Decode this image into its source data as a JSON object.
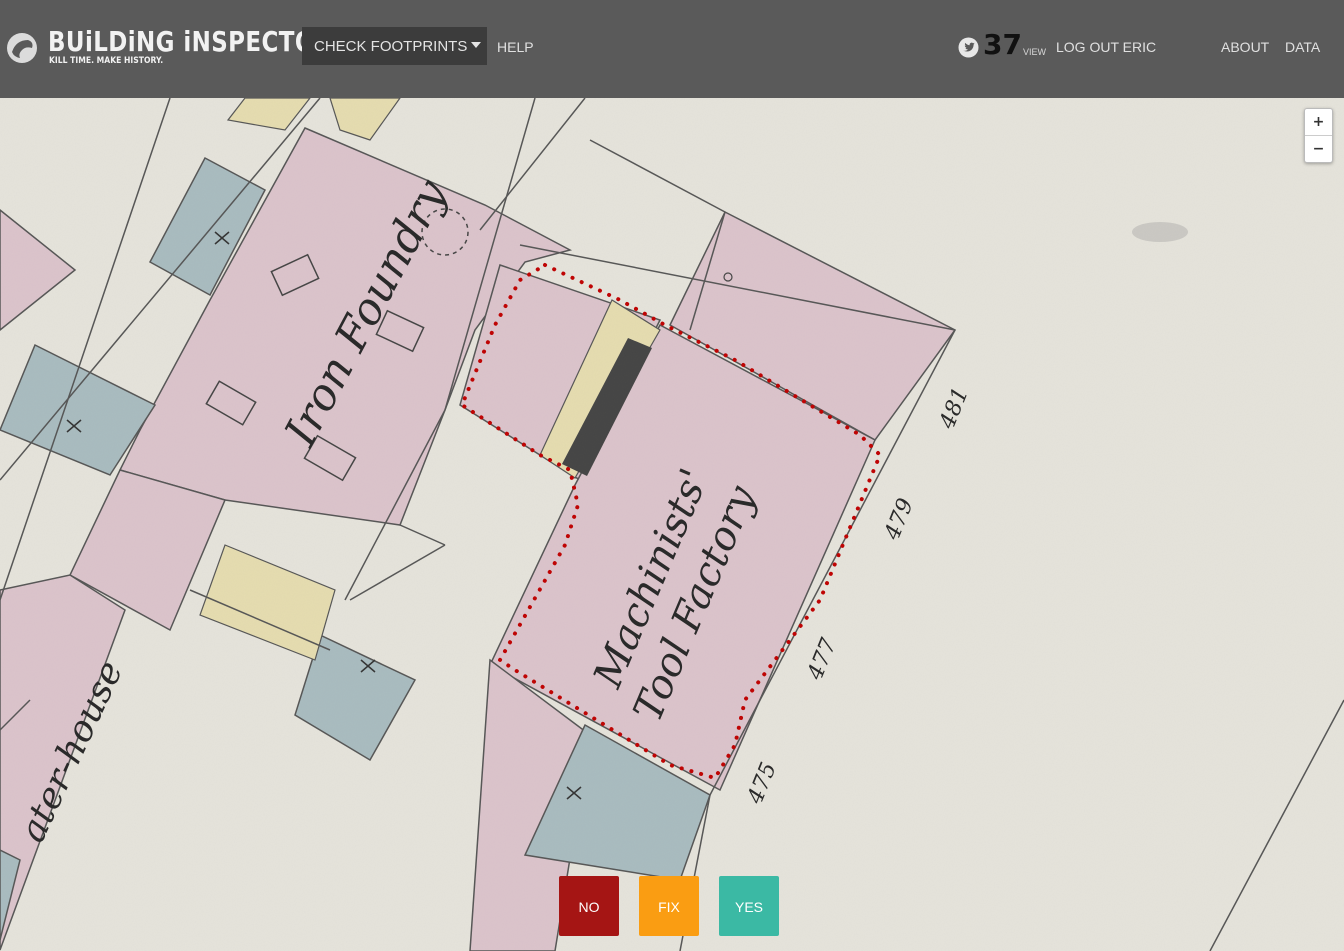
{
  "header": {
    "logo_title": "BUiLDiNG iNSPECTOR",
    "logo_tagline": "KILL TIME. MAKE HISTORY.",
    "task_menu_label": "CHECK FOOTPRINTS",
    "help_label": "HELP",
    "score": "37",
    "score_label": "VIEW",
    "logout_label": "LOG OUT ERIC",
    "about_label": "ABOUT",
    "data_label": "DATA"
  },
  "map": {
    "labels": {
      "iron_foundry": "Iron Foundry",
      "machinists": "Machinists'",
      "tool_factory": "Tool Factory",
      "water_house": "ater-house",
      "num_481": "481",
      "num_479": "479",
      "num_477": "477",
      "num_475": "475"
    },
    "zoom_in": "+",
    "zoom_out": "−",
    "colors": {
      "parchment": "#e6e4dc",
      "brick_pink": "#dcc4cc",
      "frame_blue": "#a9bcc0",
      "frame_yellow": "#e6ddb0",
      "outline_dots": "#c00000"
    }
  },
  "actions": {
    "no_label": "NO",
    "fix_label": "FIX",
    "yes_label": "YES",
    "no_color": "#a51514",
    "fix_color": "#fa9d12",
    "yes_color": "#3bb9a4"
  }
}
